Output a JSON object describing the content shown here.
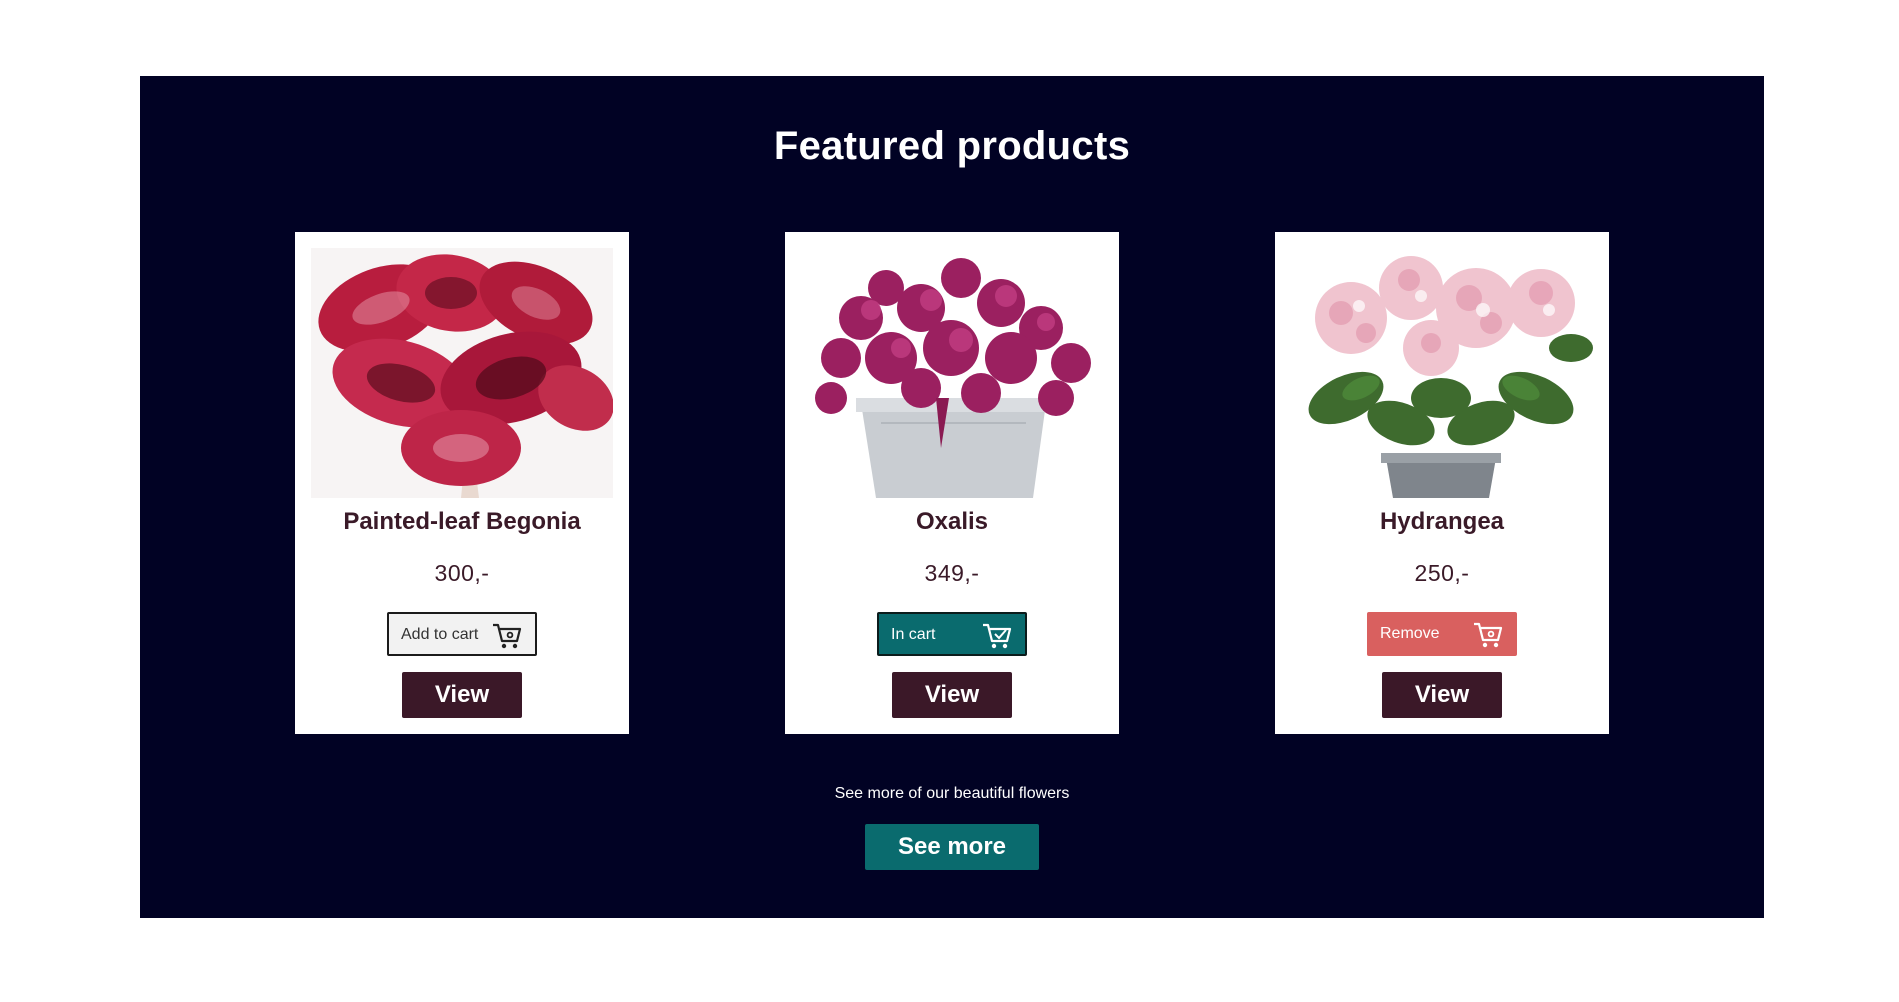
{
  "section": {
    "title": "Featured products",
    "background_color": "#010224"
  },
  "products": [
    {
      "name": "Painted-leaf Begonia",
      "price": "300,-",
      "cart_state": "add",
      "cart_label": "Add to cart",
      "cart_icon": "shopping-cart-icon",
      "view_label": "View"
    },
    {
      "name": "Oxalis",
      "price": "349,-",
      "cart_state": "in-cart",
      "cart_label": "In cart",
      "cart_icon": "cart-check-icon",
      "view_label": "View"
    },
    {
      "name": "Hydrangea",
      "price": "250,-",
      "cart_state": "remove",
      "cart_label": "Remove",
      "cart_icon": "shopping-cart-icon",
      "view_label": "View"
    }
  ],
  "see_more": {
    "text": "See more of our beautiful flowers",
    "button_label": "See more"
  },
  "colors": {
    "view_button": "#3b1828",
    "accent_teal": "#0a6b6e",
    "remove_red": "#d9605f",
    "text_dark": "#3a1a28"
  }
}
